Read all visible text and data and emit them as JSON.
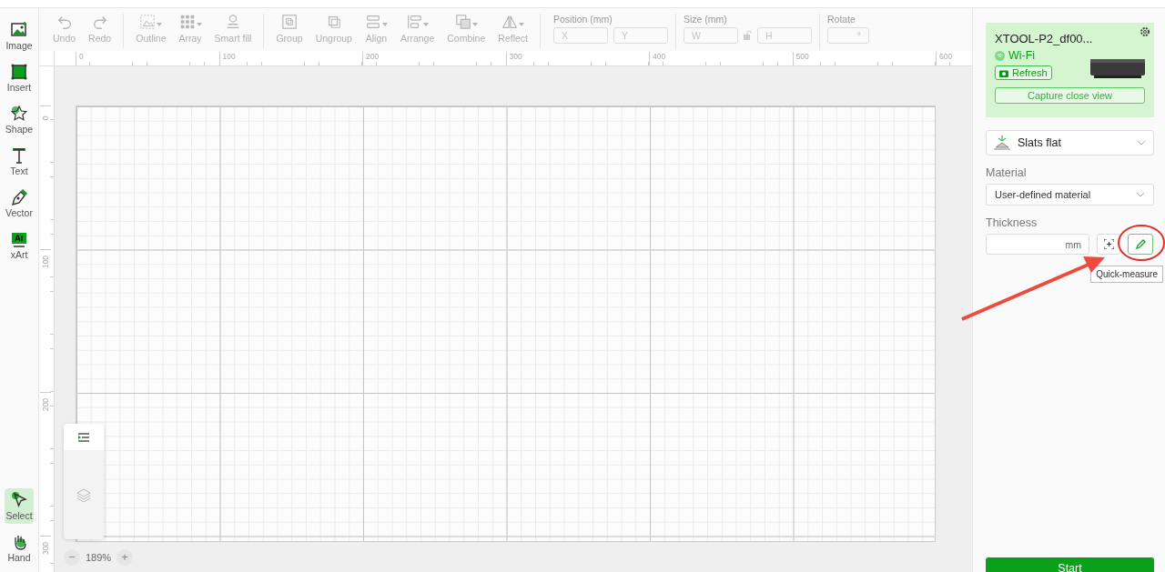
{
  "left_toolbar": {
    "tools": [
      {
        "label": "Image",
        "kind": "image",
        "selected": false
      },
      {
        "label": "Insert",
        "kind": "insert",
        "selected": false
      },
      {
        "label": "Shape",
        "kind": "shape",
        "selected": false
      },
      {
        "label": "Text",
        "kind": "text",
        "selected": false
      },
      {
        "label": "Vector",
        "kind": "vector",
        "selected": false
      },
      {
        "label": "xArt",
        "kind": "xart",
        "selected": false
      },
      {
        "label": "Select",
        "kind": "select",
        "selected": true
      },
      {
        "label": "Hand",
        "kind": "hand",
        "selected": false
      }
    ]
  },
  "toolbar": {
    "groups": [
      [
        {
          "label": "Undo",
          "kind": "undo",
          "menu": false,
          "disabled": true
        },
        {
          "label": "Redo",
          "kind": "redo",
          "menu": false,
          "disabled": true
        }
      ],
      [
        {
          "label": "Outline",
          "kind": "outline",
          "menu": true,
          "disabled": true
        },
        {
          "label": "Array",
          "kind": "array",
          "menu": true,
          "disabled": true
        },
        {
          "label": "Smart fill",
          "kind": "fill",
          "menu": false,
          "disabled": true
        }
      ],
      [
        {
          "label": "Group",
          "kind": "group",
          "menu": false,
          "disabled": true
        },
        {
          "label": "Ungroup",
          "kind": "ungroup",
          "menu": false,
          "disabled": true
        },
        {
          "label": "Align",
          "kind": "align",
          "menu": true,
          "disabled": true
        },
        {
          "label": "Arrange",
          "kind": "arrange",
          "menu": true,
          "disabled": true
        },
        {
          "label": "Combine",
          "kind": "combine",
          "menu": true,
          "disabled": true
        },
        {
          "label": "Reflect",
          "kind": "reflect",
          "menu": true,
          "disabled": true
        }
      ]
    ],
    "position": {
      "label": "Position (mm)",
      "fields": [
        {
          "placeholder": "X"
        },
        {
          "placeholder": "Y"
        }
      ]
    },
    "size": {
      "label": "Size (mm)",
      "fields": [
        {
          "placeholder": "W"
        },
        {
          "placeholder": "H"
        }
      ]
    },
    "rotate": {
      "label": "Rotate",
      "unit": "°"
    }
  },
  "rulers": {
    "horizontal": [
      "0",
      "100",
      "200",
      "300",
      "400",
      "500",
      "600"
    ],
    "vertical": [
      "0",
      "100",
      "200",
      "300"
    ]
  },
  "zoom": {
    "value": "189%",
    "minus": "−",
    "plus": "+"
  },
  "device": {
    "name": "XTOOL-P2_df00...",
    "connection": "Wi-Fi",
    "refresh": "Refresh",
    "capture": "Capture close view"
  },
  "mode": {
    "value": "Slats flat"
  },
  "material": {
    "label": "Material",
    "value": "User-defined material"
  },
  "thickness": {
    "label": "Thickness",
    "unit": "mm",
    "tooltip": "Quick-measure"
  },
  "start": "Start"
}
